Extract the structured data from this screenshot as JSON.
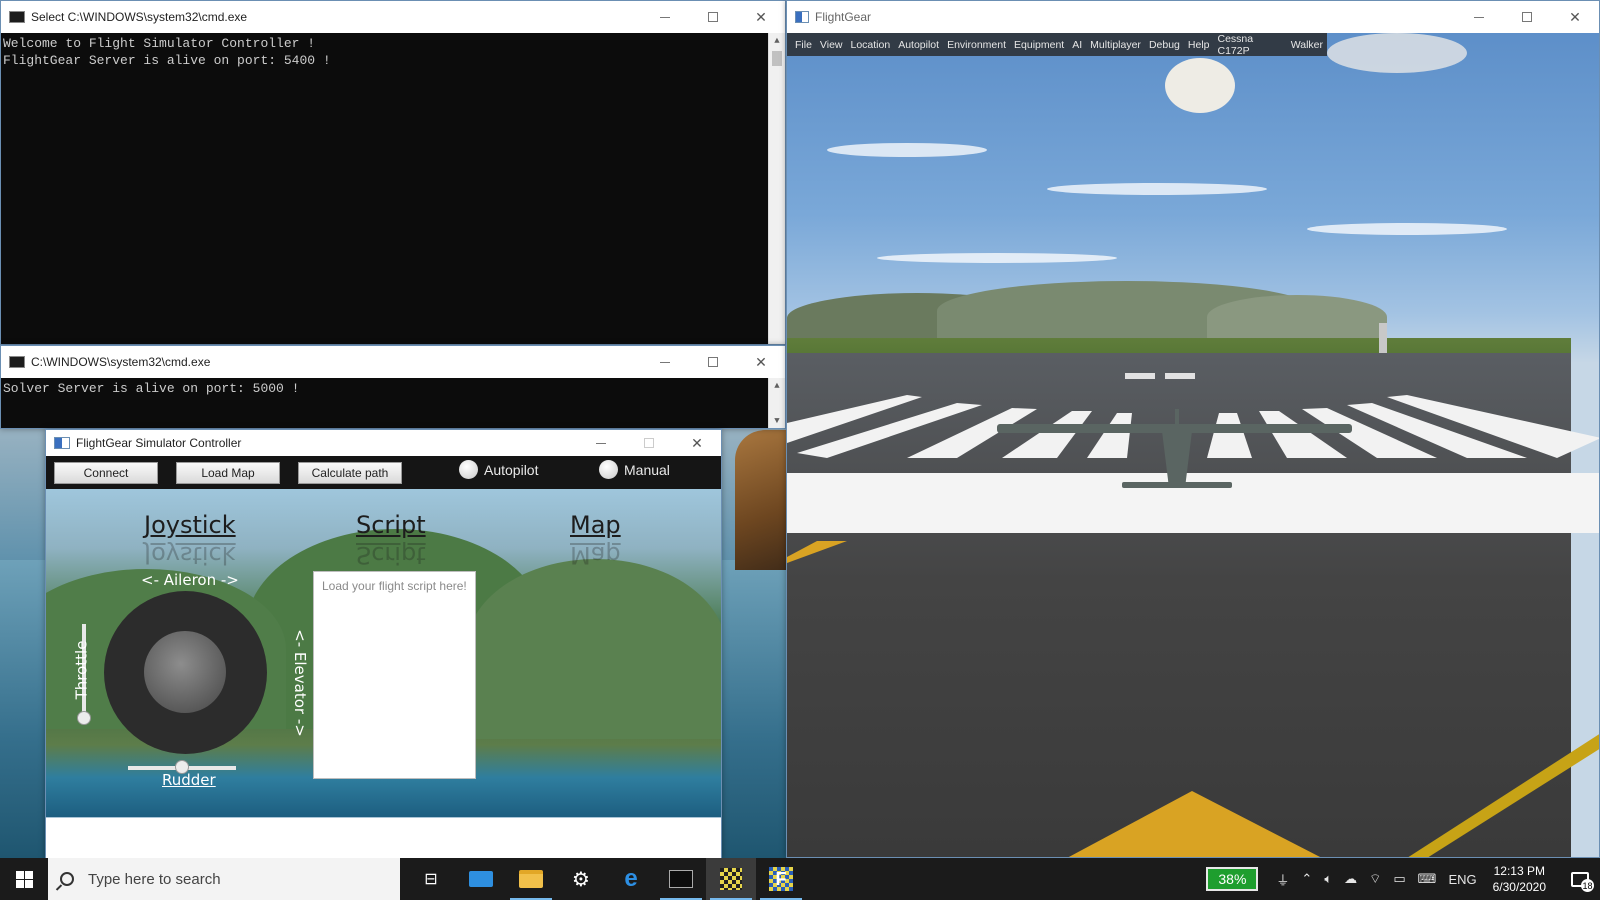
{
  "cmd1": {
    "title": "Select C:\\WINDOWS\\system32\\cmd.exe",
    "lines": [
      "Welcome to Flight Simulator Controller !",
      "FlightGear Server is alive on port: 5400 !"
    ]
  },
  "cmd2": {
    "title": "C:\\WINDOWS\\system32\\cmd.exe",
    "lines": [
      "Solver Server is alive on port: 5000 !"
    ]
  },
  "controller": {
    "title": "FlightGear Simulator Controller",
    "buttons": {
      "connect": "Connect",
      "load_map": "Load Map",
      "calc_path": "Calculate path"
    },
    "modes": {
      "autopilot": "Autopilot",
      "manual": "Manual"
    },
    "sections": {
      "joystick": "Joystick",
      "script": "Script",
      "map": "Map"
    },
    "aileron_label": "<- Aileron ->",
    "elevator_label": "<- Elevator ->",
    "throttle_label": "Throttle",
    "rudder_label": "Rudder",
    "script_placeholder": "Load your flight script here!"
  },
  "flightgear": {
    "title": "FlightGear",
    "menu": [
      "File",
      "View",
      "Location",
      "Autopilot",
      "Environment",
      "Equipment",
      "AI",
      "Multiplayer",
      "Debug",
      "Help",
      "Cessna C172P",
      "Walker"
    ]
  },
  "taskbar": {
    "search_placeholder": "Type here to search",
    "battery": "38%",
    "language": "ENG",
    "time": "12:13 PM",
    "date": "6/30/2020",
    "notifications": "18"
  },
  "colors": {
    "accent": "#76b9ed",
    "battery": "#1e9e2e",
    "console_bg": "#0c0c0c"
  }
}
